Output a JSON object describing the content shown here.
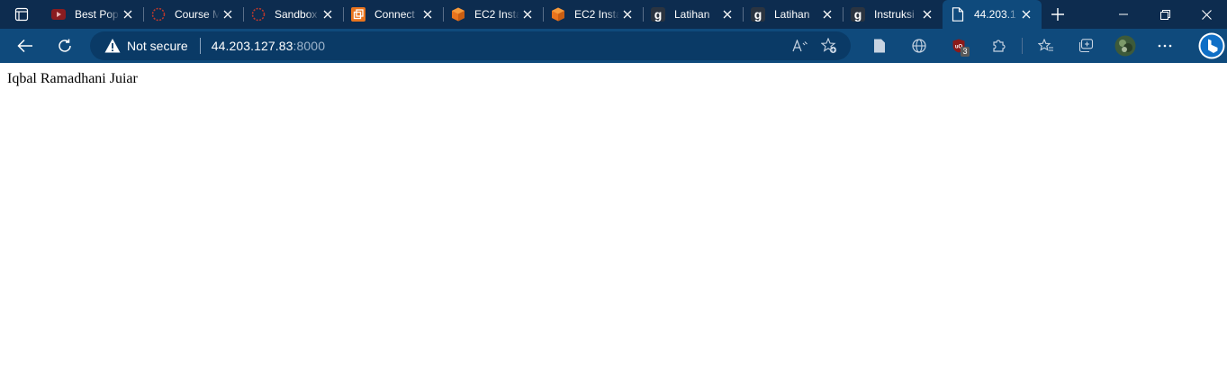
{
  "tabs": [
    {
      "title": "Best Pop",
      "icon": "youtube-icon",
      "active": false
    },
    {
      "title": "Course M",
      "icon": "loading-ring-icon",
      "active": false
    },
    {
      "title": "Sandbox",
      "icon": "loading-ring-icon",
      "active": false
    },
    {
      "title": "Connect",
      "icon": "aws-console-icon",
      "active": false
    },
    {
      "title": "EC2 Insta",
      "icon": "aws-ec2-icon",
      "active": false
    },
    {
      "title": "EC2 Insta",
      "icon": "aws-ec2-icon",
      "active": false
    },
    {
      "title": "Latihan",
      "icon": "letter-g-icon",
      "active": false
    },
    {
      "title": "Latihan",
      "icon": "letter-g-icon",
      "active": false
    },
    {
      "title": "Instruksi",
      "icon": "letter-g-icon",
      "active": false
    },
    {
      "title": "44.203.1",
      "icon": "page-icon",
      "active": true
    }
  ],
  "address_bar": {
    "security_label": "Not secure",
    "host": "44.203.127.83",
    "port": ":8000"
  },
  "extensions": {
    "ublock_badge": "3"
  },
  "page": {
    "text": "Iqbal Ramadhani Juiar"
  },
  "colors": {
    "tabstrip": "#0d2c4f",
    "toolbar": "#0f4a7c",
    "omnibox": "#0a3a66"
  }
}
